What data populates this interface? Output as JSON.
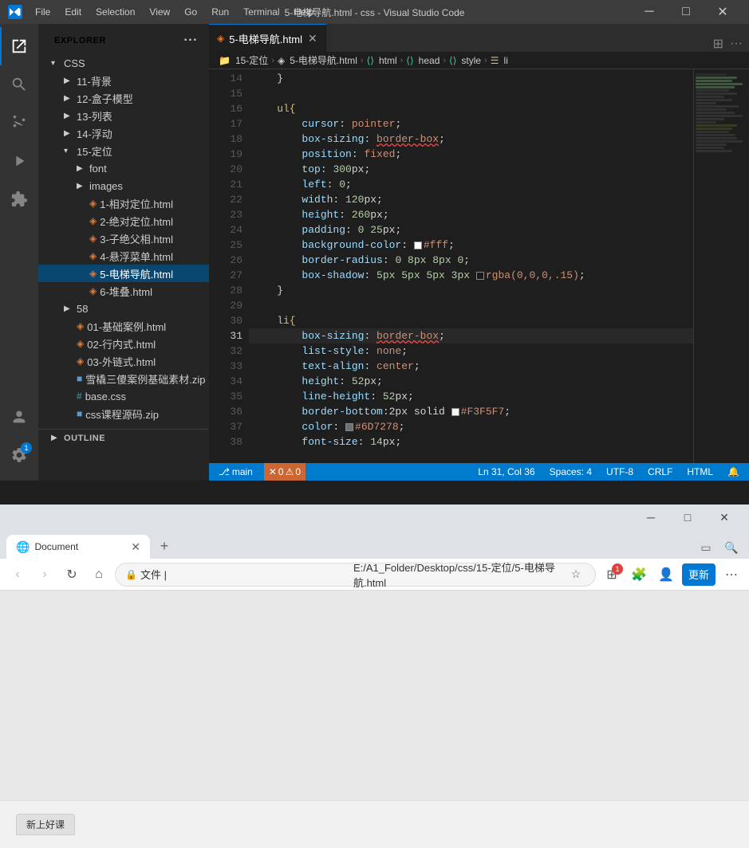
{
  "titlebar": {
    "title": "5-电梯导航.html - css - Visual Studio Code",
    "menus": [
      "File",
      "Edit",
      "Selection",
      "View",
      "Go",
      "Run",
      "Terminal",
      "Help"
    ],
    "min": "−",
    "max": "□",
    "close": "×"
  },
  "sidebar": {
    "title": "EXPLORER",
    "root_folder": "CSS",
    "items": [
      {
        "id": "folder-11",
        "label": "11-背景",
        "type": "folder",
        "indent": 2,
        "open": false
      },
      {
        "id": "folder-12",
        "label": "12-盒子模型",
        "type": "folder",
        "indent": 2,
        "open": false
      },
      {
        "id": "folder-13",
        "label": "13-列表",
        "type": "folder",
        "indent": 2,
        "open": false
      },
      {
        "id": "folder-14",
        "label": "14-浮动",
        "type": "folder",
        "indent": 2,
        "open": false
      },
      {
        "id": "folder-15",
        "label": "15-定位",
        "type": "folder",
        "indent": 2,
        "open": true
      },
      {
        "id": "font",
        "label": "font",
        "type": "folder",
        "indent": 3,
        "open": false
      },
      {
        "id": "images",
        "label": "images",
        "type": "folder",
        "indent": 3,
        "open": false
      },
      {
        "id": "file-1",
        "label": "1-相对定位.html",
        "type": "html",
        "indent": 4
      },
      {
        "id": "file-2",
        "label": "2-绝对定位.html",
        "type": "html",
        "indent": 4
      },
      {
        "id": "file-3",
        "label": "3-子绝父相.html",
        "type": "html",
        "indent": 4
      },
      {
        "id": "file-4",
        "label": "4-悬浮菜单.html",
        "type": "html",
        "indent": 4
      },
      {
        "id": "file-5",
        "label": "5-电梯导航.html",
        "type": "html",
        "indent": 4,
        "active": true
      },
      {
        "id": "file-6",
        "label": "6-堆叠.html",
        "type": "html",
        "indent": 4
      },
      {
        "id": "folder-58",
        "label": "58",
        "type": "folder",
        "indent": 2,
        "open": false
      },
      {
        "id": "file-01",
        "label": "01-基础案例.html",
        "type": "html",
        "indent": 2
      },
      {
        "id": "file-02",
        "label": "02-行内式.html",
        "type": "html",
        "indent": 2
      },
      {
        "id": "file-03",
        "label": "03-外链式.html",
        "type": "html",
        "indent": 2
      },
      {
        "id": "file-zip1",
        "label": "雪橇三傻案例基础素材.zip",
        "type": "zip",
        "indent": 2
      },
      {
        "id": "file-base",
        "label": "base.css",
        "type": "css",
        "indent": 2
      },
      {
        "id": "file-zip2",
        "label": "css课程源码.zip",
        "type": "zip",
        "indent": 2
      }
    ]
  },
  "editor": {
    "tab_label": "5-电梯导航.html",
    "breadcrumb": [
      "15-定位",
      "5-电梯导航.html",
      "html",
      "head",
      "style",
      "li"
    ],
    "lines": [
      {
        "num": 14,
        "tokens": [
          {
            "t": "    }",
            "c": "c-punct"
          }
        ]
      },
      {
        "num": 15,
        "tokens": []
      },
      {
        "num": 16,
        "tokens": [
          {
            "t": "    ul{",
            "c": "c-selector"
          }
        ]
      },
      {
        "num": 17,
        "tokens": [
          {
            "t": "        cursor",
            "c": "c-property"
          },
          {
            "t": ": ",
            "c": ""
          },
          {
            "t": "pointer",
            "c": "c-value"
          },
          {
            "t": ";",
            "c": ""
          }
        ]
      },
      {
        "num": 18,
        "tokens": [
          {
            "t": "        box-sizing",
            "c": "c-property"
          },
          {
            "t": ": ",
            "c": ""
          },
          {
            "t": "border-box",
            "c": "c-value"
          },
          {
            "t": ";",
            "c": ""
          }
        ],
        "red_underline": true
      },
      {
        "num": 19,
        "tokens": [
          {
            "t": "        position",
            "c": "c-property"
          },
          {
            "t": ": ",
            "c": ""
          },
          {
            "t": "fixed",
            "c": "c-value"
          },
          {
            "t": ";",
            "c": ""
          }
        ]
      },
      {
        "num": 20,
        "tokens": [
          {
            "t": "        top",
            "c": "c-property"
          },
          {
            "t": ": ",
            "c": ""
          },
          {
            "t": "300",
            "c": "c-number"
          },
          {
            "t": "px;",
            "c": ""
          }
        ]
      },
      {
        "num": 21,
        "tokens": [
          {
            "t": "        left",
            "c": "c-property"
          },
          {
            "t": ": ",
            "c": ""
          },
          {
            "t": "0",
            "c": "c-number"
          },
          {
            "t": ";",
            "c": ""
          }
        ]
      },
      {
        "num": 22,
        "tokens": [
          {
            "t": "        width",
            "c": "c-property"
          },
          {
            "t": ": ",
            "c": ""
          },
          {
            "t": "120",
            "c": "c-number"
          },
          {
            "t": "px;",
            "c": ""
          }
        ]
      },
      {
        "num": 23,
        "tokens": [
          {
            "t": "        height",
            "c": "c-property"
          },
          {
            "t": ": ",
            "c": ""
          },
          {
            "t": "260",
            "c": "c-number"
          },
          {
            "t": "px;",
            "c": ""
          }
        ]
      },
      {
        "num": 24,
        "tokens": [
          {
            "t": "        padding",
            "c": "c-property"
          },
          {
            "t": ": ",
            "c": ""
          },
          {
            "t": "0 25",
            "c": "c-number"
          },
          {
            "t": "px;",
            "c": ""
          }
        ]
      },
      {
        "num": 25,
        "tokens": [
          {
            "t": "        background-color",
            "c": "c-property"
          },
          {
            "t": ": ",
            "c": ""
          },
          {
            "t": "color-fff",
            "c": "color-box-fff"
          },
          {
            "t": "#fff",
            "c": "c-value"
          },
          {
            "t": ";",
            "c": ""
          }
        ]
      },
      {
        "num": 26,
        "tokens": [
          {
            "t": "        border-radius",
            "c": "c-property"
          },
          {
            "t": ": ",
            "c": ""
          },
          {
            "t": "0 8px 8px 0",
            "c": "c-number"
          },
          {
            "t": ";",
            "c": ""
          }
        ]
      },
      {
        "num": 27,
        "tokens": [
          {
            "t": "        box-shadow",
            "c": "c-property"
          },
          {
            "t": ": ",
            "c": ""
          },
          {
            "t": "5px 5px 5px 3px ",
            "c": "c-number"
          },
          {
            "t": "color-rgba",
            "c": "color-box-rgba"
          },
          {
            "t": "rgba(0,0,0,.15)",
            "c": "c-value"
          },
          {
            "t": ";",
            "c": ""
          }
        ]
      },
      {
        "num": 28,
        "tokens": [
          {
            "t": "    }",
            "c": "c-punct"
          }
        ]
      },
      {
        "num": 29,
        "tokens": []
      },
      {
        "num": 30,
        "tokens": [
          {
            "t": "    li{",
            "c": "c-selector"
          }
        ]
      },
      {
        "num": 31,
        "tokens": [
          {
            "t": "        box-sizing",
            "c": "c-property"
          },
          {
            "t": ": ",
            "c": ""
          },
          {
            "t": "border-box",
            "c": "c-value"
          },
          {
            "t": ";",
            "c": ""
          }
        ],
        "red_underline": true,
        "current": true
      },
      {
        "num": 32,
        "tokens": [
          {
            "t": "        list-style",
            "c": "c-property"
          },
          {
            "t": ": ",
            "c": ""
          },
          {
            "t": "none",
            "c": "c-value"
          },
          {
            "t": ";",
            "c": ""
          }
        ]
      },
      {
        "num": 33,
        "tokens": [
          {
            "t": "        text-align",
            "c": "c-property"
          },
          {
            "t": ": ",
            "c": ""
          },
          {
            "t": "center",
            "c": "c-value"
          },
          {
            "t": ";",
            "c": ""
          }
        ]
      },
      {
        "num": 34,
        "tokens": [
          {
            "t": "        height",
            "c": "c-property"
          },
          {
            "t": ": ",
            "c": ""
          },
          {
            "t": "52",
            "c": "c-number"
          },
          {
            "t": "px;",
            "c": ""
          }
        ]
      },
      {
        "num": 35,
        "tokens": [
          {
            "t": "        line-height",
            "c": "c-property"
          },
          {
            "t": ": ",
            "c": ""
          },
          {
            "t": "52",
            "c": "c-number"
          },
          {
            "t": "px;",
            "c": ""
          }
        ]
      },
      {
        "num": 36,
        "tokens": [
          {
            "t": "        border-bottom",
            "c": "c-property"
          },
          {
            "t": ":2px solid ",
            "c": ""
          },
          {
            "t": "color-f3f5f7",
            "c": "color-box-f3f5f7"
          },
          {
            "t": "#F3F5F7",
            "c": "c-value"
          },
          {
            "t": ";",
            "c": ""
          }
        ]
      },
      {
        "num": 37,
        "tokens": [
          {
            "t": "        color",
            "c": "c-property"
          },
          {
            "t": ": ",
            "c": ""
          },
          {
            "t": "color-6d7278",
            "c": "color-box-6d7278"
          },
          {
            "t": "#6D7278",
            "c": "c-value"
          },
          {
            "t": ";",
            "c": ""
          }
        ]
      },
      {
        "num": 38,
        "tokens": [
          {
            "t": "        font-size",
            "c": "c-property"
          },
          {
            "t": ": ",
            "c": ""
          },
          {
            "t": "14",
            "c": "c-number"
          },
          {
            "t": "px;",
            "c": ""
          }
        ]
      }
    ]
  },
  "statusbar": {
    "errors": "0",
    "warnings": "0",
    "line": "Ln 31, Col 36",
    "spaces": "Spaces: 4",
    "encoding": "UTF-8",
    "eol": "CRLF",
    "language": "HTML"
  },
  "browser": {
    "tab_label": "Document",
    "url": "E:/A1_Folder/Desktop/css/15-定位/5-电梯导航.html",
    "update_btn": "更新",
    "bottom_label": "新上好课"
  }
}
